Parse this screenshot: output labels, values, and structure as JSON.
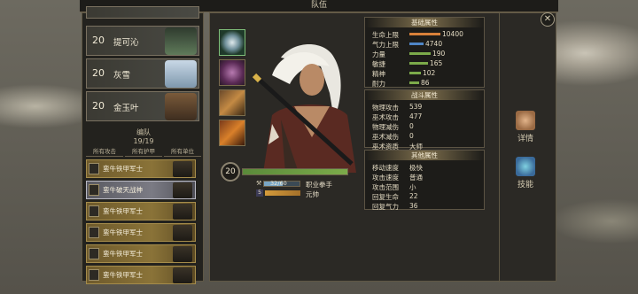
{
  "title": "队伍",
  "heroes": [
    {
      "level": "20",
      "name": "提可沁"
    },
    {
      "level": "20",
      "name": "灰雪"
    },
    {
      "level": "20",
      "name": "金玉叶"
    }
  ],
  "formation": {
    "label": "编队",
    "count": "19/19"
  },
  "filters": [
    "所有攻击",
    "所有护甲",
    "所有单位"
  ],
  "units": [
    {
      "name": "蛮牛铁甲军士",
      "selected": false
    },
    {
      "name": "蛮牛破天战神",
      "selected": true
    },
    {
      "name": "蛮牛铁甲军士",
      "selected": false
    },
    {
      "name": "蛮牛铁甲军士",
      "selected": false
    },
    {
      "name": "蛮牛铁甲军士",
      "selected": false
    },
    {
      "name": "蛮牛铁甲军士",
      "selected": false
    },
    {
      "name": "蛮牛铁甲军士",
      "selected": false
    }
  ],
  "character": {
    "level": "20",
    "exp_text": "32/60",
    "exp_fraction": 0.53,
    "job": "职业拳手",
    "slot_number": "5",
    "job2": "元帅"
  },
  "base_stats": {
    "header": "基础属性",
    "rows": [
      {
        "label": "生命上限",
        "value": "10400",
        "color": "#d9813a",
        "fill": 0.8
      },
      {
        "label": "气力上限",
        "value": "4740",
        "color": "#4f86c6",
        "fill": 0.36
      },
      {
        "label": "力量",
        "value": "190",
        "color": "#7cab4a",
        "fill": 0.55
      },
      {
        "label": "敏捷",
        "value": "165",
        "color": "#7cab4a",
        "fill": 0.48
      },
      {
        "label": "精神",
        "value": "102",
        "color": "#7cab4a",
        "fill": 0.3
      },
      {
        "label": "耐力",
        "value": "86",
        "color": "#7cab4a",
        "fill": 0.25
      }
    ]
  },
  "battle_stats": {
    "header": "战斗属性",
    "rows": [
      {
        "label": "物理攻击",
        "value": "539"
      },
      {
        "label": "巫术攻击",
        "value": "477"
      },
      {
        "label": "物理减伤",
        "value": "0"
      },
      {
        "label": "巫术减伤",
        "value": "0"
      },
      {
        "label": "巫术资质",
        "value": "大师"
      }
    ]
  },
  "other_stats": {
    "header": "其他属性",
    "rows": [
      {
        "label": "移动速度",
        "value": "极快"
      },
      {
        "label": "攻击速度",
        "value": "普通"
      },
      {
        "label": "攻击范围",
        "value": "小"
      },
      {
        "label": "回复生命",
        "value": "22"
      },
      {
        "label": "回复气力",
        "value": "36"
      }
    ]
  },
  "side_tabs": [
    {
      "label": "详情",
      "icon": "arm-icon"
    },
    {
      "label": "技能",
      "icon": "book-icon"
    }
  ],
  "colors": {
    "hp": "#7cab4a",
    "gold": "#a58c4b",
    "frame": "#5f5745"
  }
}
